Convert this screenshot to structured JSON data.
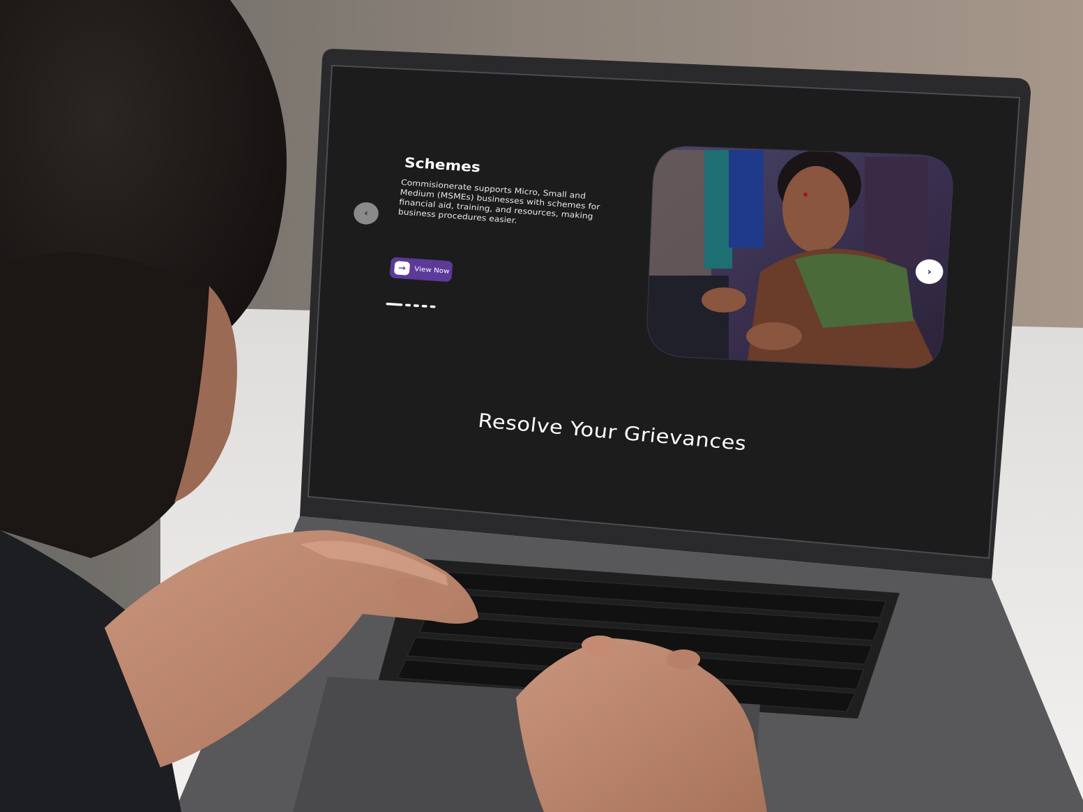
{
  "slide": {
    "title": "Schemes",
    "description": "Commisionerate supports Micro, Small and Medium (MSMEs) businesses with schemes for financial aid, training, and resources, making business procedures easier.",
    "cta_label": "View Now",
    "prev_icon": "chevron-left-icon",
    "next_icon": "chevron-right-icon",
    "cta_icon": "arrow-right-icon",
    "dot_count": 5,
    "active_dot": 1
  },
  "section": {
    "heading": "Resolve Your Grievances"
  },
  "colors": {
    "screen_bg": "#1c1c1c",
    "accent": "#5b3a9a",
    "text": "#ffffff"
  }
}
